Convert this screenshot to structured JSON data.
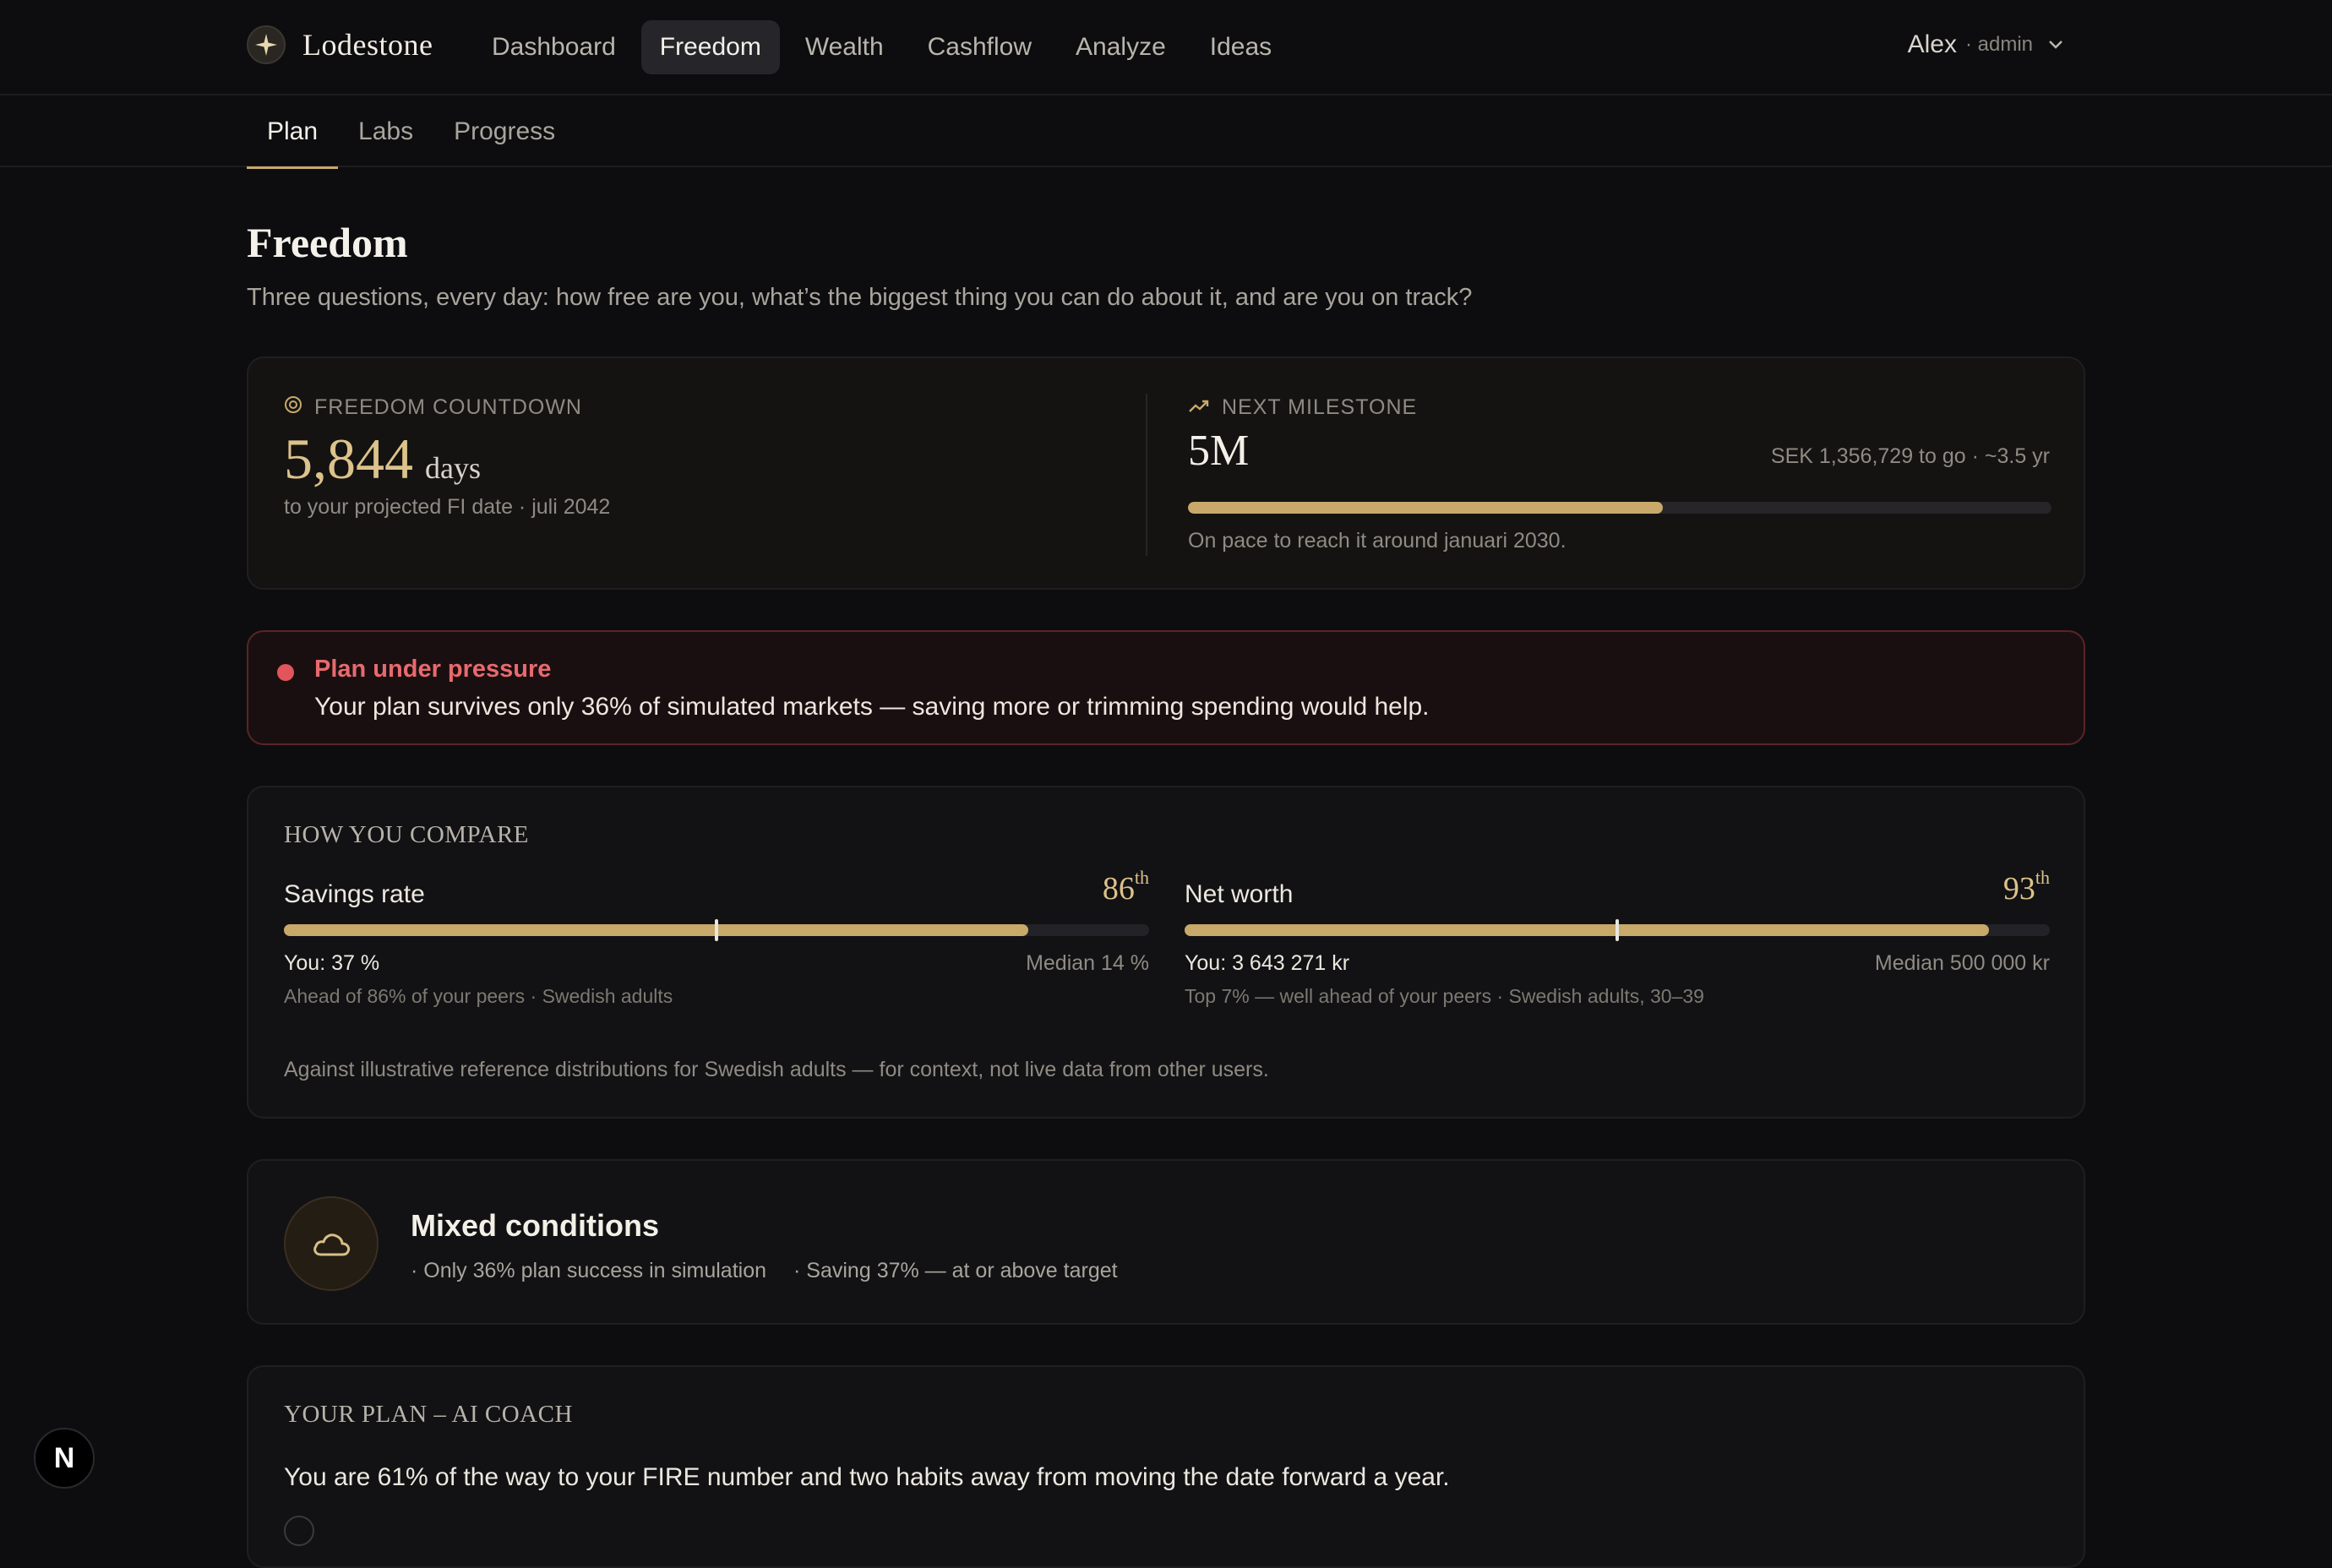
{
  "app": {
    "brand": "Lodestone"
  },
  "nav": {
    "items": [
      {
        "label": "Dashboard",
        "active": false
      },
      {
        "label": "Freedom",
        "active": true
      },
      {
        "label": "Wealth",
        "active": false
      },
      {
        "label": "Cashflow",
        "active": false
      },
      {
        "label": "Analyze",
        "active": false
      },
      {
        "label": "Ideas",
        "active": false
      }
    ]
  },
  "user": {
    "name": "Alex",
    "role": "· admin"
  },
  "subtabs": [
    {
      "label": "Plan",
      "active": true
    },
    {
      "label": "Labs",
      "active": false
    },
    {
      "label": "Progress",
      "active": false
    }
  ],
  "page": {
    "title": "Freedom",
    "subtitle": "Three questions, every day: how free are you, what’s the biggest thing you can do about it, and are you on track?"
  },
  "countdown": {
    "label": "FREEDOM COUNTDOWN",
    "value": "5,844",
    "unit": "days",
    "note": "to your projected FI date · juli 2042"
  },
  "milestone": {
    "label": "NEXT MILESTONE",
    "value": "5M",
    "to_go": "SEK 1,356,729 to go · ~3.5 yr",
    "progress": 0.55,
    "note": "On pace to reach it around januari 2030."
  },
  "alert": {
    "title": "Plan under pressure",
    "text": "Your plan survives only 36% of simulated markets — saving more or trimming spending would help."
  },
  "compare": {
    "heading": "HOW YOU COMPARE",
    "items": [
      {
        "label": "Savings rate",
        "rank": "86",
        "rank_suffix": "th",
        "fill": 0.86,
        "median_pos": 0.5,
        "you": "You: 37 %",
        "median": "Median 14 %",
        "note": "Ahead of 86% of your peers · Swedish adults"
      },
      {
        "label": "Net worth",
        "rank": "93",
        "rank_suffix": "th",
        "fill": 0.93,
        "median_pos": 0.5,
        "you": "You: 3 643 271 kr",
        "median": "Median 500 000 kr",
        "note": "Top 7% — well ahead of your peers · Swedish adults, 30–39"
      }
    ],
    "footnote": "Against illustrative reference distributions for Swedish adults — for context, not live data from other users."
  },
  "conditions": {
    "title": "Mixed conditions",
    "points": [
      "· Only 36% plan success in simulation",
      "· Saving 37% — at or above target"
    ]
  },
  "coach": {
    "heading": "YOUR PLAN – AI COACH",
    "text": "You are 61% of the way to your FIRE number and two habits away from moving the date forward a year."
  },
  "fab": {
    "label": "N"
  },
  "colors": {
    "accent": "#c8a96a",
    "danger": "#e0565c",
    "background": "#0d0d0f"
  }
}
